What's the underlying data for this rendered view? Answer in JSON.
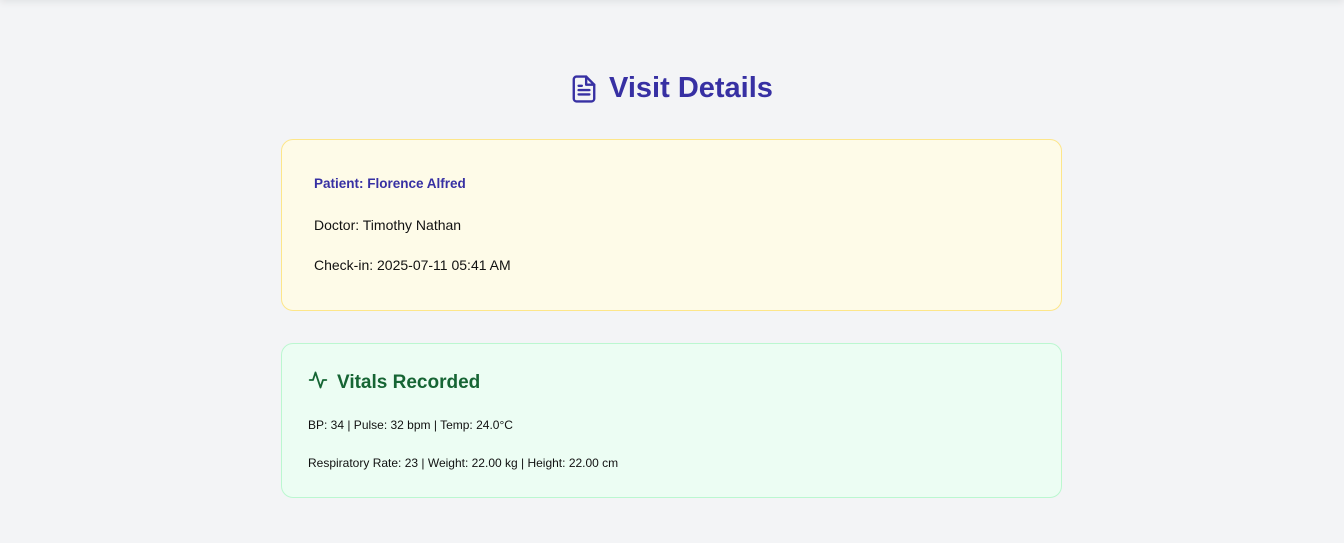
{
  "header": {
    "title": "Visit Details",
    "icon": "document-icon",
    "color": "#3730a3"
  },
  "visit": {
    "patient": "Patient: Florence Alfred",
    "doctor": "Doctor: Timothy Nathan",
    "checkin": "Check-in: 2025-07-11 05:41 AM",
    "background": "#fefbe8",
    "border": "#fde68a"
  },
  "vitals": {
    "title": "Vitals Recorded",
    "icon": "activity-pulse-icon",
    "line1": "BP: 34 | Pulse: 32 bpm | Temp: 24.0°C",
    "line2": "Respiratory Rate: 23 | Weight: 22.00 kg | Height: 22.00 cm",
    "background": "#ecfdf3",
    "border": "#bbf7d0",
    "accent": "#166534"
  }
}
